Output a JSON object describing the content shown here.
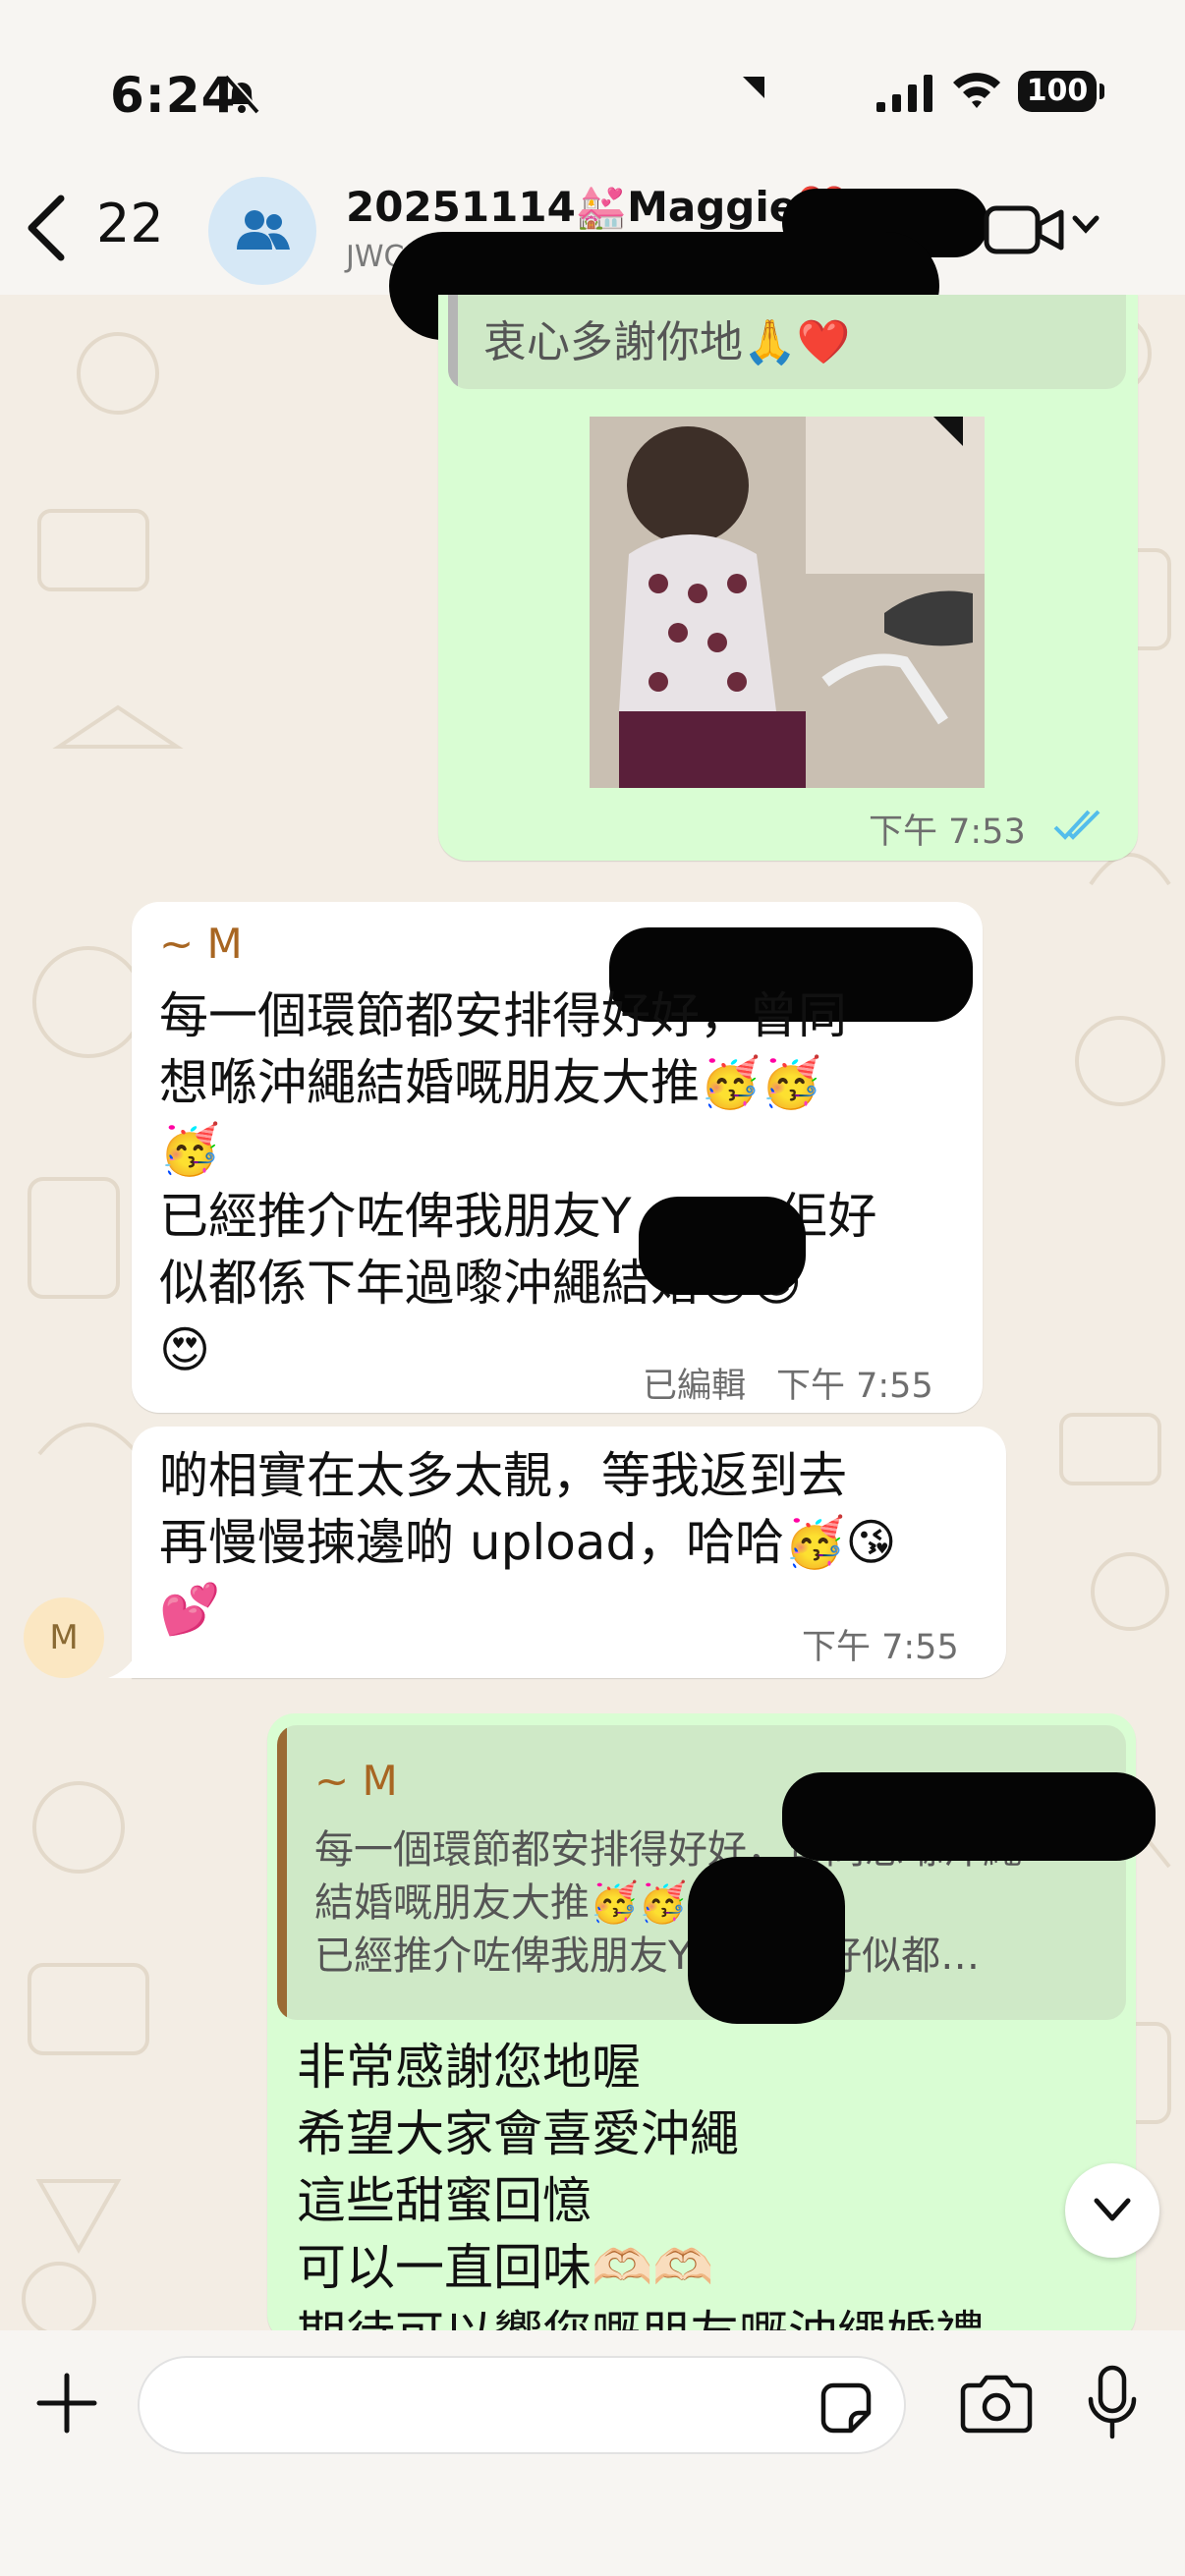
{
  "status_bar": {
    "time": "6:24",
    "battery": "100"
  },
  "header": {
    "back_count": "22",
    "title": "20251114💒Maggie❤️",
    "subtitle": "JWC co. Ltd · Maggie&"
  },
  "messages": {
    "m1": {
      "quote_text": "衷心多謝你地🙏❤️",
      "time": "下午 7:53"
    },
    "m2": {
      "sender": "~ M",
      "lines": [
        "每一個環節都安排得好好，曾同",
        "想喺沖繩結婚嘅朋友大推🥳🥳",
        "🥳",
        "已經推介咗俾我朋友Y　　，佢好",
        "似都係下年過嚟沖繩結婚😍😍",
        "😍"
      ],
      "edited": "已編輯",
      "time": "下午 7:55"
    },
    "m3": {
      "lines": [
        "啲相實在太多太靚，等我返到去",
        "再慢慢揀邊啲 upload，哈哈🥳😘",
        "💕"
      ],
      "time": "下午 7:55",
      "avatar": "M"
    },
    "m4": {
      "quote_sender": "~ M",
      "quote_lines": [
        "每一個環節都安排得好好，曾同想喺沖繩",
        "結婚嘅朋友大推🥳🥳🥳",
        "已經推介咗俾我朋友Y　　 佢好似都…"
      ],
      "lines": [
        "非常感謝您地喔",
        "希望大家會喜愛沖繩",
        "這些甜蜜回憶",
        "可以一直回味🫶🏻🫶🏻",
        "期待可以響您嘅朋友嘅沖繩婚禮"
      ]
    }
  },
  "colors": {
    "outgoing": "#d9fdd3",
    "incoming": "#ffffff",
    "tick": "#53bdeb",
    "quote_bar_out": "#9b6a34"
  },
  "icons": {
    "back": "chevron-left-icon",
    "group": "group-icon",
    "video": "video-call-icon",
    "plus": "plus-icon",
    "sticker": "sticker-icon",
    "camera": "camera-icon",
    "mic": "microphone-icon",
    "scroll": "chevron-down-icon"
  }
}
